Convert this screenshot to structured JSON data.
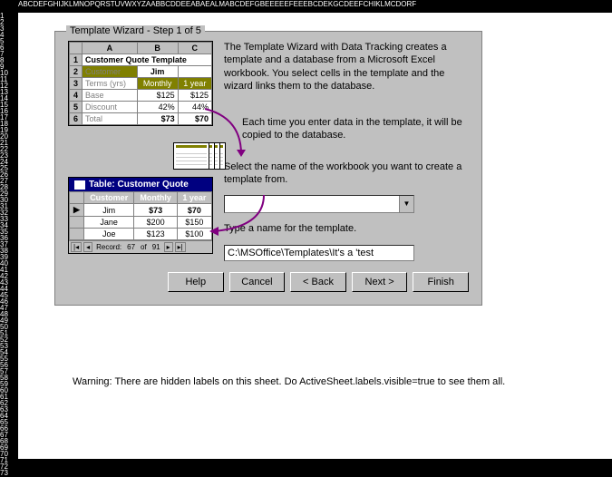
{
  "wizard": {
    "title": "Template Wizard - Step 1 of 5",
    "intro": "The Template Wizard with Data Tracking creates a template and a database from a Microsoft Excel workbook.  You select cells in the template and the wizard links them to the database.",
    "copy_text": "Each time you enter data in the template, it will be copied to the database.",
    "select_label": "Select the name of the workbook you want to create a template from.",
    "name_label": "Type a name for the template.",
    "name_value": "C:\\MSOffice\\Templates\\It's a 'test",
    "buttons": {
      "help": "Help",
      "cancel": "Cancel",
      "back": "< Back",
      "next": "Next >",
      "finish": "Finish"
    }
  },
  "preview_sheet": {
    "cols": [
      "A",
      "B",
      "C"
    ],
    "rows": [
      {
        "n": "1",
        "a": "Customer Quote Template",
        "span": 3
      },
      {
        "n": "2",
        "a": "Customer",
        "b": "Jim",
        "c": ""
      },
      {
        "n": "3",
        "a": "Terms (yrs)",
        "b": "Monthly",
        "c": "1 year"
      },
      {
        "n": "4",
        "a": "Base",
        "b": "$125",
        "c": "$125"
      },
      {
        "n": "5",
        "a": "Discount",
        "b": "42%",
        "c": "44%"
      },
      {
        "n": "6",
        "a": "Total",
        "b": "$73",
        "c": "$70"
      }
    ]
  },
  "db_table": {
    "title": "Table: Customer Quote",
    "cols": [
      "Customer",
      "Monthly",
      "1 year"
    ],
    "rows": [
      [
        "Jim",
        "$73",
        "$70"
      ],
      [
        "Jane",
        "$200",
        "$150"
      ],
      [
        "Joe",
        "$123",
        "$100"
      ]
    ],
    "nav": {
      "record_label": "Record:",
      "current": "67",
      "of_label": "of",
      "total": "91"
    }
  },
  "warning": "Warning:  There are hidden labels on this sheet.  Do ActiveSheet.labels.visible=true to see them all.",
  "ruler_cols": "ABCDEFGHIJKLMNOPQRSTUVWXYZAABBCDDEEABAEALMABCDEFGBEEEEEFEEEBCDEKGCDEEFCHIKLMCDORF"
}
